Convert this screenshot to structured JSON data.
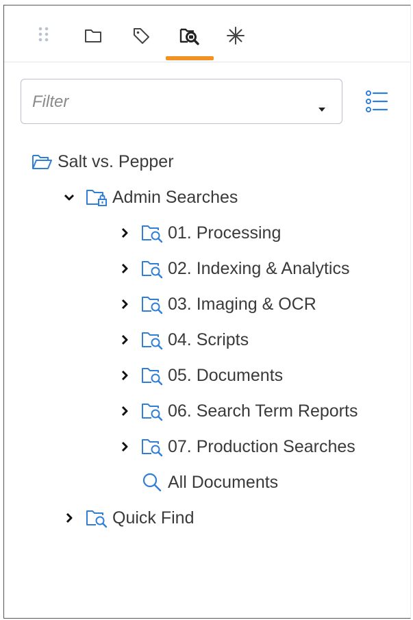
{
  "toolbar": {
    "tabs": [
      {
        "name": "drag-handle",
        "icon": "grip-dots-icon"
      },
      {
        "name": "folders",
        "icon": "folder-icon"
      },
      {
        "name": "tags",
        "icon": "tag-icon"
      },
      {
        "name": "saved-searches",
        "icon": "search-folder-icon",
        "active": true
      },
      {
        "name": "clusters",
        "icon": "asterisk-icon"
      }
    ]
  },
  "filter": {
    "placeholder": "Filter",
    "value": ""
  },
  "tree": {
    "root": {
      "label": "Salt vs. Pepper",
      "icon": "open-folder-icon"
    },
    "admin": {
      "label": "Admin Searches",
      "icon": "locked-folder-icon",
      "expanded": true
    },
    "children": [
      {
        "label": "01. Processing",
        "icon": "search-folder-icon"
      },
      {
        "label": "02. Indexing & Analytics",
        "icon": "search-folder-icon"
      },
      {
        "label": "03. Imaging & OCR",
        "icon": "search-folder-icon"
      },
      {
        "label": "04. Scripts",
        "icon": "search-folder-icon"
      },
      {
        "label": "05. Documents",
        "icon": "search-folder-icon"
      },
      {
        "label": "06. Search Term Reports",
        "icon": "search-folder-icon"
      },
      {
        "label": "07. Production Searches",
        "icon": "search-folder-icon"
      }
    ],
    "all_documents": {
      "label": "All Documents",
      "icon": "search-icon"
    },
    "quick_find": {
      "label": "Quick Find",
      "icon": "search-folder-icon"
    }
  },
  "colors": {
    "accent": "#f39224",
    "icon_blue": "#2f7ed8",
    "text": "#3a3a3a"
  }
}
